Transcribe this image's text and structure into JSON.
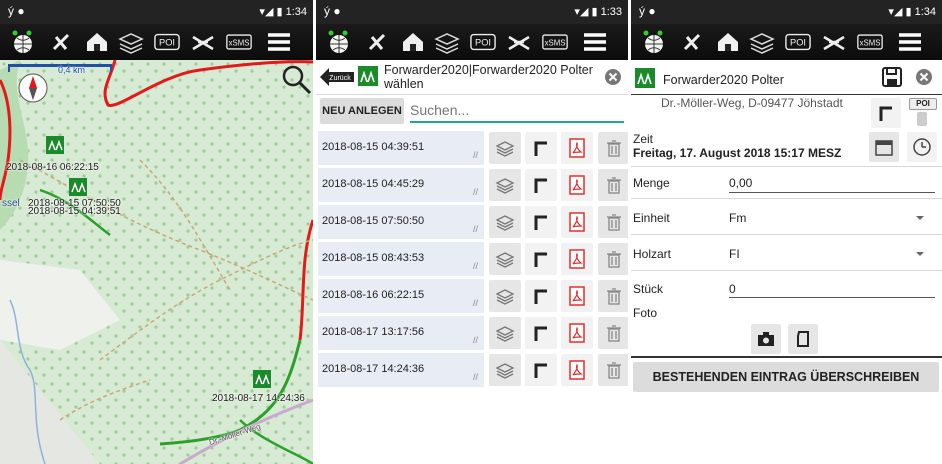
{
  "status": {
    "screen1_time": "1:34",
    "screen2_time": "1:33",
    "screen3_time": "1:34"
  },
  "toolbar": {
    "icons": [
      "gps-globe-icon",
      "tools-icon",
      "house-icon",
      "layers-icon",
      "poi-icon",
      "axes-icon",
      "sms-icon",
      "menu-icon"
    ],
    "poi_label": "POI",
    "sms_label": "xSMS"
  },
  "map": {
    "scale_label": "0,4 km",
    "place_label": "ssel",
    "road_label": "Dr.-Möller-Weg",
    "markers": [
      {
        "label": "2018-08-16 06:22:15"
      },
      {
        "label": "2018-08-15 07:50:50"
      },
      {
        "label": "2018-08-15 04:39:51"
      },
      {
        "label": "2018-08-17 14:24:36"
      }
    ],
    "colors": {
      "background": "#d7ead3",
      "road_red": "#e31a1c",
      "road_green": "#2ca02c",
      "path": "#c8a878"
    }
  },
  "select_screen": {
    "back_label": "Zurück",
    "title": "Forwarder2020|Forwarder2020 Polter wählen",
    "new_button": "NEU ANLEGEN",
    "search_placeholder": "Suchen...",
    "rows": [
      {
        "timestamp": "2018-08-15 04:39:51"
      },
      {
        "timestamp": "2018-08-15 04:45:29"
      },
      {
        "timestamp": "2018-08-15 07:50:50"
      },
      {
        "timestamp": "2018-08-15 08:43:53"
      },
      {
        "timestamp": "2018-08-16 06:22:15"
      },
      {
        "timestamp": "2018-08-17 13:17:56"
      },
      {
        "timestamp": "2018-08-17 14:24:36"
      }
    ],
    "row_icons": [
      "layers-icon",
      "corner-icon",
      "pdf-icon",
      "trash-icon"
    ]
  },
  "edit_screen": {
    "title": "Forwarder2020 Polter",
    "address": "Dr.-Möller-Weg, D-09477 Jöhstadt",
    "zeit_label": "Zeit",
    "zeit_value": "Freitag, 17. August 2018 15:17 MESZ",
    "menge_label": "Menge",
    "menge_value": "0,00",
    "einheit_label": "Einheit",
    "einheit_value": "Fm",
    "holzart_label": "Holzart",
    "holzart_value": "FI",
    "stueck_label": "Stück",
    "stueck_value": "0",
    "foto_label": "Foto",
    "poi_label": "POI",
    "save_button": "BESTEHENDEN EINTRAG ÜBERSCHREIBEN",
    "accent": "#26a69a"
  }
}
